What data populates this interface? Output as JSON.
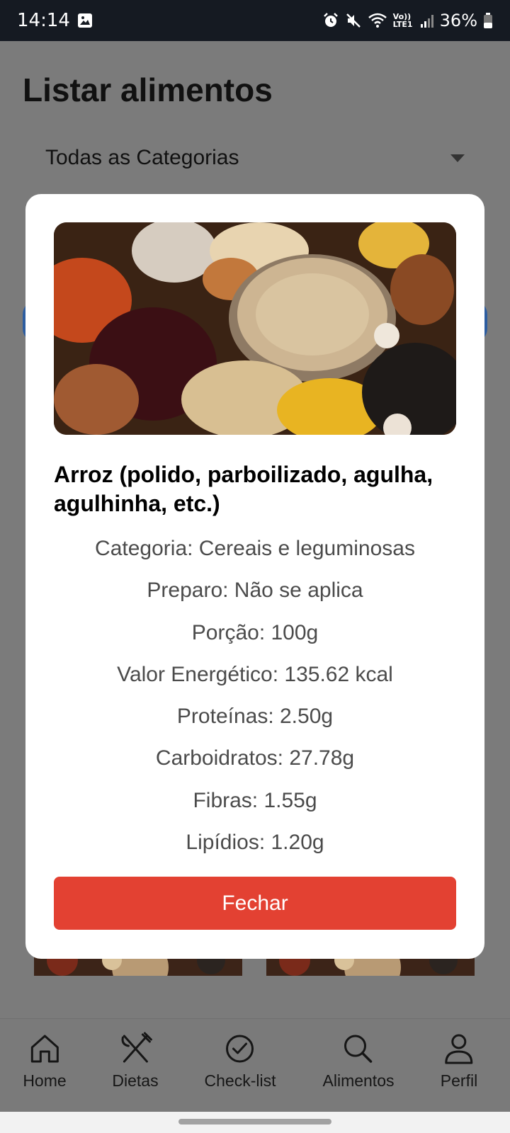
{
  "status_bar": {
    "time": "14:14",
    "battery": "36%",
    "network_label": "Vo)) LTE1"
  },
  "page": {
    "title": "Listar alimentos",
    "category_select": "Todas as Categorias"
  },
  "modal": {
    "food_name": "Arroz (polido, parboilizado, agulha, agulhinha, etc.)",
    "info": [
      "Categoria: Cereais e leguminosas",
      "Preparo: Não se aplica",
      "Porção: 100g",
      "Valor Energético: 135.62 kcal",
      "Proteínas: 2.50g",
      "Carboidratos: 27.78g",
      "Fibras: 1.55g",
      "Lipídios: 1.20g"
    ],
    "close_label": "Fechar"
  },
  "nav": [
    {
      "label": "Home",
      "icon": "home-icon"
    },
    {
      "label": "Dietas",
      "icon": "utensils-icon"
    },
    {
      "label": "Check-list",
      "icon": "check-circle-icon"
    },
    {
      "label": "Alimentos",
      "icon": "search-icon"
    },
    {
      "label": "Perfil",
      "icon": "user-icon"
    }
  ],
  "colors": {
    "accent_close": "#e34132",
    "status_bar": "#151a22",
    "overlay": "#7b7b7b"
  }
}
